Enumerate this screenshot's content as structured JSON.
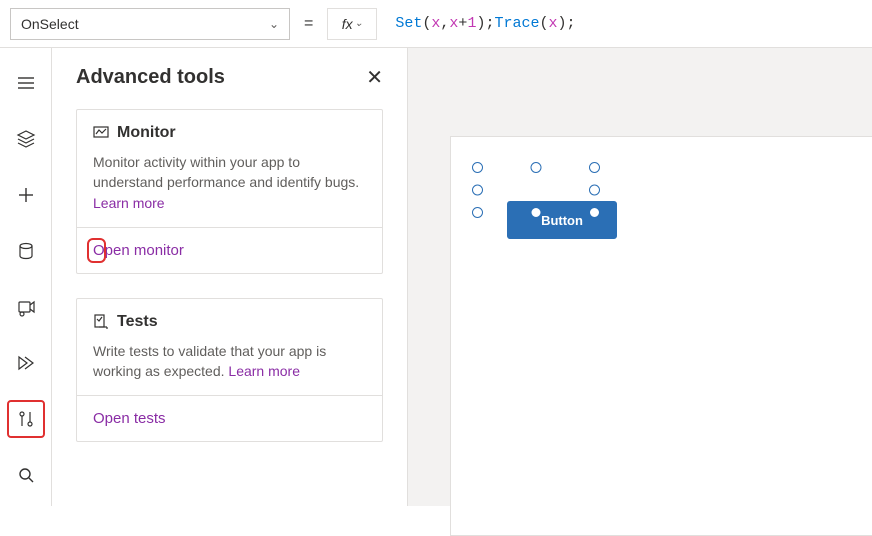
{
  "formulaBar": {
    "property": "OnSelect",
    "fxLabel": "fx",
    "formula": {
      "tokens": [
        {
          "t": "fn",
          "v": "Set"
        },
        {
          "t": "paren",
          "v": "( "
        },
        {
          "t": "ident",
          "v": "x"
        },
        {
          "t": "punct",
          "v": ", "
        },
        {
          "t": "ident",
          "v": "x"
        },
        {
          "t": "punct",
          "v": "+"
        },
        {
          "t": "ident",
          "v": "1"
        },
        {
          "t": "paren",
          "v": " )"
        },
        {
          "t": "punct",
          "v": "; "
        },
        {
          "t": "fn",
          "v": "Trace"
        },
        {
          "t": "paren",
          "v": "( "
        },
        {
          "t": "ident",
          "v": "x"
        },
        {
          "t": "paren",
          "v": " )"
        },
        {
          "t": "punct",
          "v": ";"
        }
      ],
      "raw": "Set( x, x+1 ); Trace( x );"
    }
  },
  "leftRail": {
    "items": [
      "hamburger",
      "tree",
      "insert",
      "data",
      "media",
      "power-automate",
      "advanced-tools",
      "search"
    ],
    "selected": "advanced-tools"
  },
  "panel": {
    "title": "Advanced tools",
    "cards": [
      {
        "icon": "monitor",
        "title": "Monitor",
        "desc": "Monitor activity within your app to understand performance and identify bugs. ",
        "learnMore": "Learn more",
        "action": "Open monitor",
        "highlighted": true
      },
      {
        "icon": "tests",
        "title": "Tests",
        "desc": "Write tests to validate that your app is working as expected. ",
        "learnMore": "Learn more",
        "action": "Open tests",
        "highlighted": false
      }
    ]
  },
  "canvas": {
    "buttonLabel": "Button"
  }
}
